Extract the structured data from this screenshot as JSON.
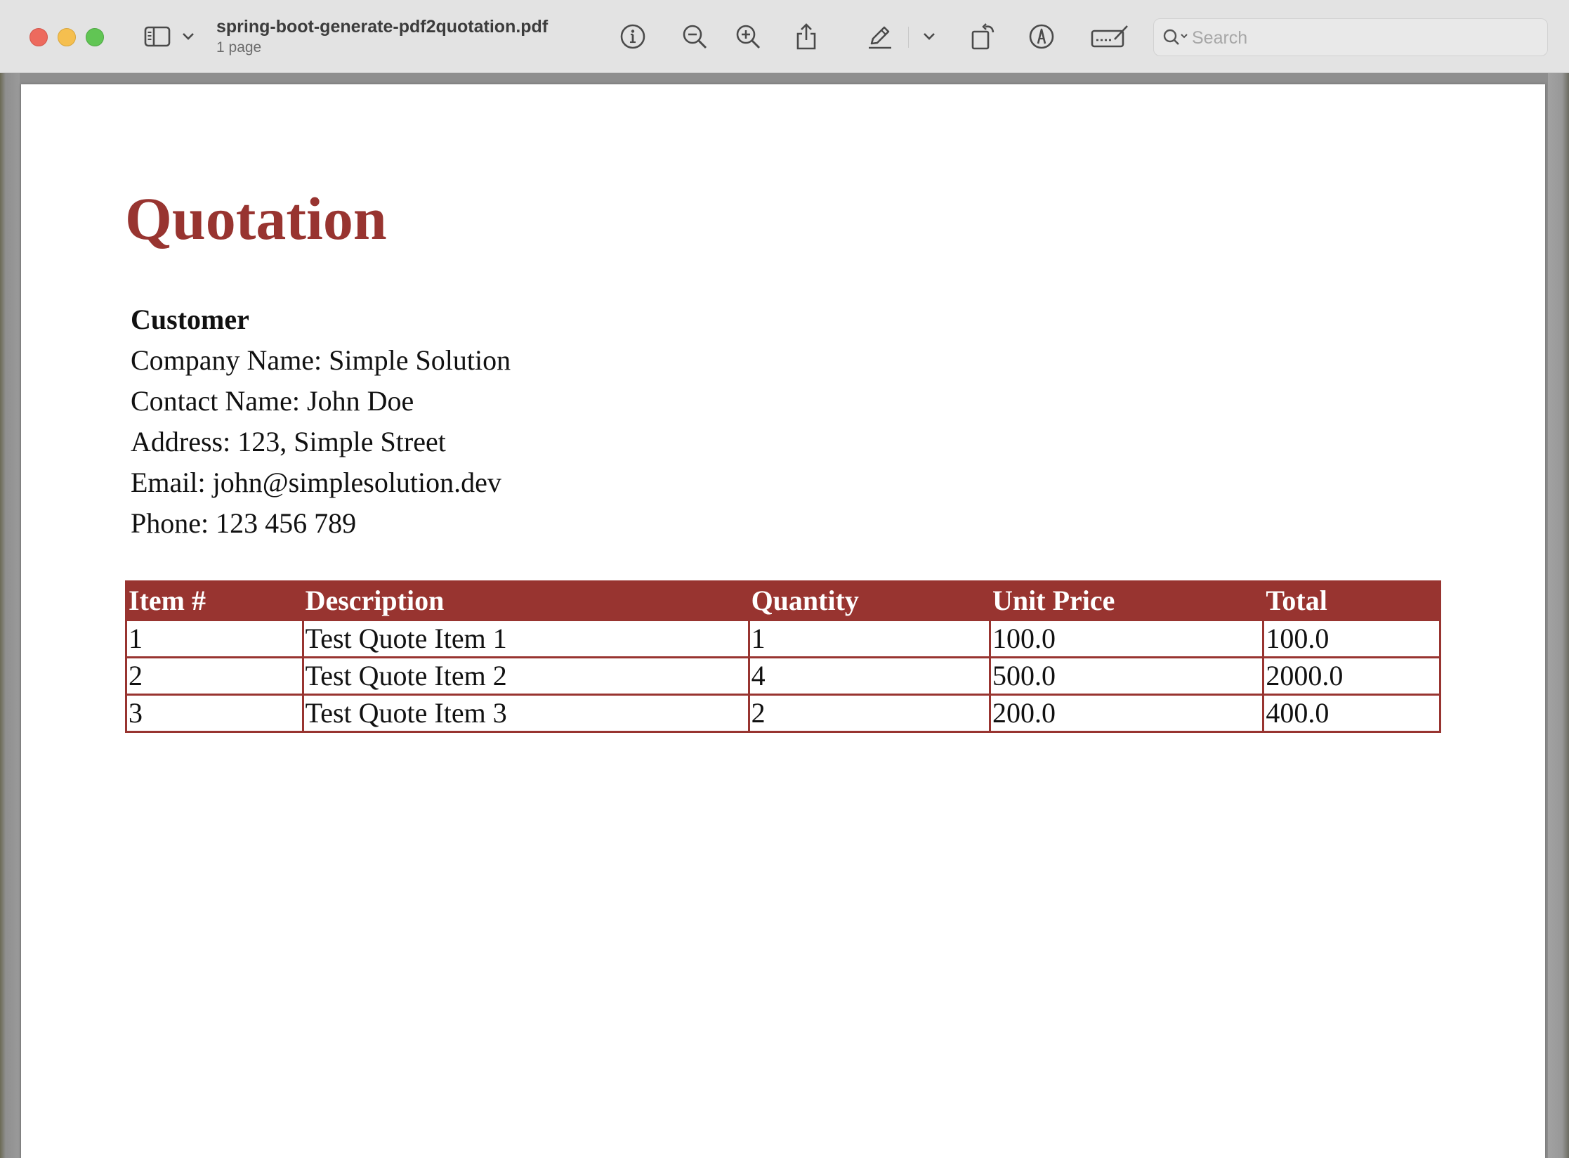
{
  "toolbar": {
    "file_name": "spring-boot-generate-pdf2quotation.pdf",
    "page_count": "1 page",
    "search_placeholder": "Search",
    "icons": [
      "sidebar-icon",
      "chevron-down-icon",
      "info-icon",
      "zoom-out-icon",
      "zoom-in-icon",
      "share-icon",
      "highlight-pen-icon",
      "chevron-down-icon",
      "rotate-icon",
      "markup-icon",
      "signature-icon",
      "search-icon"
    ]
  },
  "document": {
    "title": "Quotation",
    "customer": {
      "heading": "Customer",
      "company": "Company Name: Simple Solution",
      "contact": "Contact Name: John Doe",
      "address": "Address: 123, Simple Street",
      "email": "Email: john@simplesolution.dev",
      "phone": "Phone: 123 456 789"
    },
    "table": {
      "headers": [
        "Item #",
        "Description",
        "Quantity",
        "Unit Price",
        "Total"
      ],
      "rows": [
        [
          "1",
          "Test Quote Item 1",
          "1",
          "100.0",
          "100.0"
        ],
        [
          "2",
          "Test Quote Item 2",
          "4",
          "500.0",
          "2000.0"
        ],
        [
          "3",
          "Test Quote Item 3",
          "2",
          "200.0",
          "400.0"
        ]
      ]
    }
  },
  "colors": {
    "accent": "#983430",
    "toolbar_bg": "#e3e3e3",
    "traffic_red": "#ed6a5e",
    "traffic_yellow": "#f5bf4f",
    "traffic_green": "#61c554"
  }
}
